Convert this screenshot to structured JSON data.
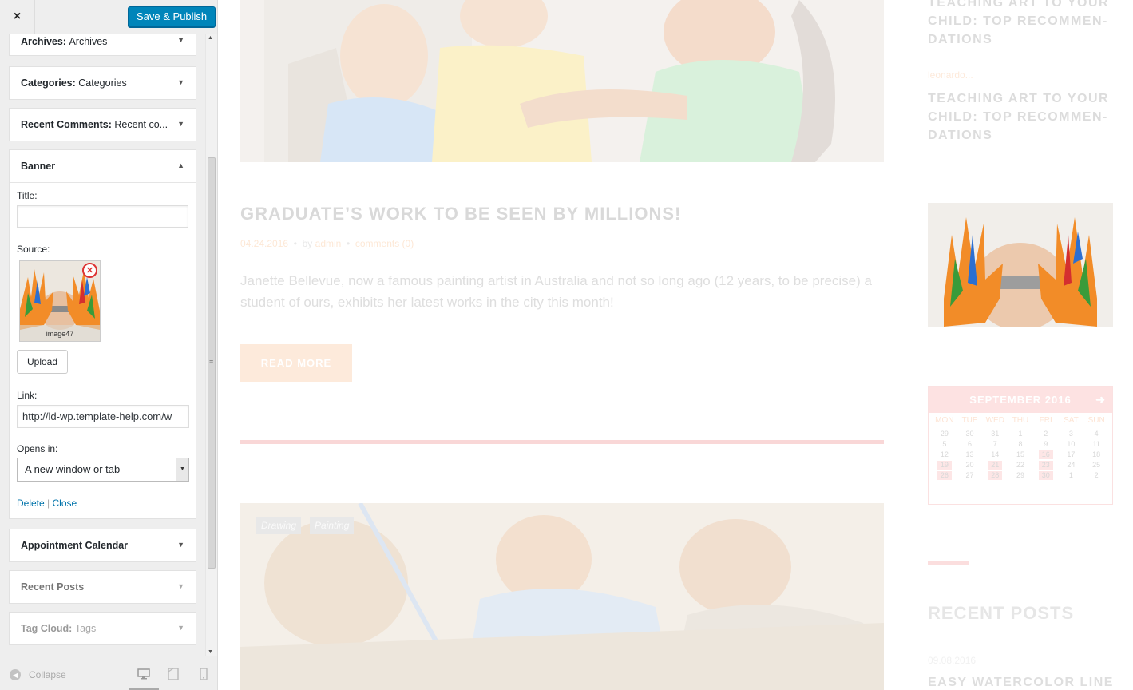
{
  "topbar": {
    "close_label": "×",
    "save_label": "Save & Publish"
  },
  "widgets": {
    "archives": {
      "type": "Archives:",
      "name": "Archives"
    },
    "categories": {
      "type": "Categories:",
      "name": "Categories"
    },
    "recent_comments": {
      "type": "Recent Comments:",
      "name": "Recent co..."
    },
    "banner": {
      "title": "Banner",
      "title_label": "Title:",
      "title_value": "",
      "source_label": "Source:",
      "image_name": "image47",
      "upload_label": "Upload",
      "link_label": "Link:",
      "link_value": "http://ld-wp.template-help.com/w",
      "opens_in_label": "Opens in:",
      "opens_in_value": "A new window or tab",
      "delete_label": "Delete",
      "separator": "|",
      "close_label": "Close"
    },
    "appointment_calendar": {
      "name": "Appointment Calendar"
    },
    "recent_posts": {
      "name": "Recent Posts"
    },
    "tag_cloud": {
      "type": "Tag Cloud:",
      "name": "Tags"
    }
  },
  "footer": {
    "collapse_label": "Collapse",
    "devices": [
      "desktop-icon",
      "tablet-icon",
      "mobile-icon"
    ]
  },
  "preview": {
    "post": {
      "title": "GRADUATE’S WORK TO BE SEEN BY MILLIONS!",
      "date": "04.24.2016",
      "by": "by",
      "author": "admin",
      "comments": "comments (0)",
      "excerpt": "Janette Bellevue, now a famous painting artist in Australia and not so long ago (12 years, to be precise) a student of ours, exhibits her latest works in the city this month!",
      "read_more": "READ MORE"
    },
    "tags": [
      "Drawing",
      "Painting"
    ],
    "sidebar": {
      "top_title": "TEACHING ART TO YOUR CHILD: TOP RECOMMEN-DATIONS",
      "author": "leonardo...",
      "second_title": "TEACHING ART TO YOUR CHILD: TOP RECOMMEN-DATIONS",
      "calendar": {
        "month": "SEPTEMBER 2016",
        "days": [
          "MON",
          "TUE",
          "WED",
          "THU",
          "FRI",
          "SAT",
          "SUN"
        ],
        "cells": [
          "29",
          "30",
          "31",
          "1",
          "2",
          "3",
          "4",
          "5",
          "6",
          "7",
          "8",
          "9",
          "10",
          "11",
          "12",
          "13",
          "14",
          "15",
          "16",
          "17",
          "18",
          "19",
          "20",
          "21",
          "22",
          "23",
          "24",
          "25",
          "26",
          "27",
          "28",
          "29",
          "30",
          "1",
          "2"
        ],
        "highlighted": [
          "16",
          "19",
          "21",
          "23",
          "26",
          "28",
          "30"
        ]
      },
      "recent_posts_title": "RECENT POSTS",
      "recent_date": "09.08.2016",
      "recent_item": "EASY WATERCOLOR LINE"
    }
  },
  "colors": {
    "accent": "#0085ba",
    "pink": "#f9d7d7",
    "peach": "#fdeadb"
  }
}
